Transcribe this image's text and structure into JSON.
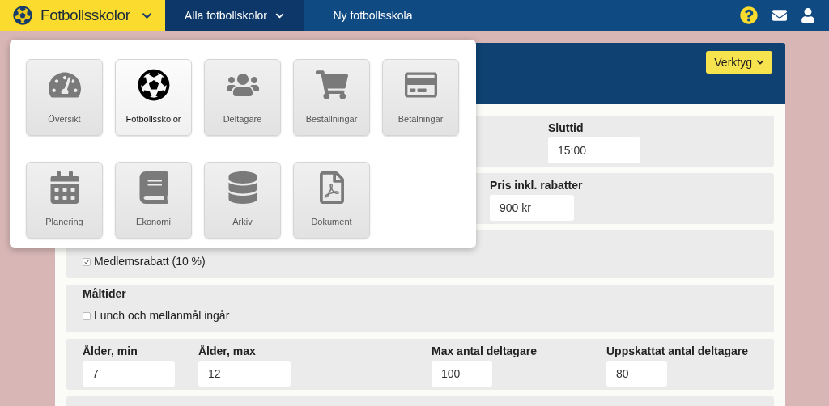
{
  "nav": {
    "brand": "Fotbollsskolor",
    "items": [
      {
        "label": "Alla fotbollskolor",
        "dropdown": true,
        "selected": true
      },
      {
        "label": "Ny fotbollsskola",
        "dropdown": false,
        "selected": false
      }
    ]
  },
  "panel": {
    "tools_button": "Verktyg"
  },
  "sections": [
    {
      "kind": "fields",
      "fields": [
        {
          "label": "Sluttid",
          "value": "15:00"
        }
      ]
    },
    {
      "kind": "fields",
      "fields": [
        {
          "label": "Pris inkl. rabatter",
          "value": "900 kr"
        }
      ]
    },
    {
      "kind": "checks",
      "checks": [
        {
          "label": "Medlemsrabatt (10 %)",
          "checked": true
        }
      ]
    },
    {
      "kind": "checks",
      "title": "Måltider",
      "checks": [
        {
          "label": "Lunch och mellanmål ingår",
          "checked": false
        }
      ]
    },
    {
      "kind": "fields",
      "fields": [
        {
          "label": "Ålder, min",
          "value": "7"
        },
        {
          "label": "Ålder, max",
          "value": "12"
        },
        {
          "label": "Max antal deltagare",
          "value": "100"
        },
        {
          "label": "Uppskattat antal deltagare",
          "value": "80"
        }
      ]
    }
  ],
  "menu": {
    "tiles": [
      {
        "label": "Översikt",
        "selected": false
      },
      {
        "label": "Fotbollsskolor",
        "selected": true
      },
      {
        "label": "Deltagare",
        "selected": false
      },
      {
        "label": "Beställningar",
        "selected": false
      },
      {
        "label": "Betalningar",
        "selected": false
      },
      {
        "label": "Planering",
        "selected": false
      },
      {
        "label": "Ekonomi",
        "selected": false
      },
      {
        "label": "Arkiv",
        "selected": false
      },
      {
        "label": "Dokument",
        "selected": false
      }
    ]
  }
}
